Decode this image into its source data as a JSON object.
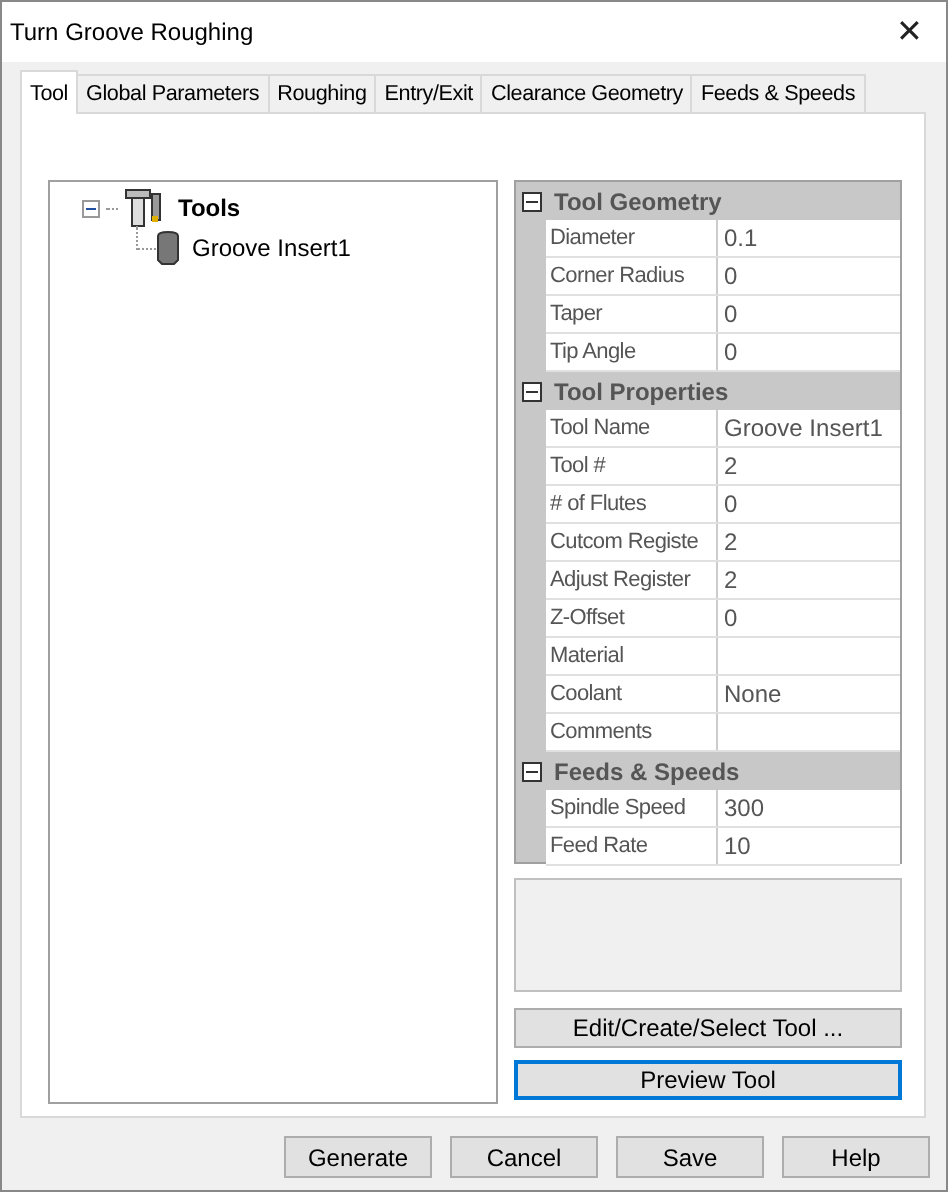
{
  "window": {
    "title": "Turn Groove Roughing",
    "close": "✕"
  },
  "tabs": [
    {
      "label": "Tool",
      "selected": true
    },
    {
      "label": "Global Parameters",
      "selected": false
    },
    {
      "label": "Roughing",
      "selected": false
    },
    {
      "label": "Entry/Exit",
      "selected": false
    },
    {
      "label": "Clearance Geometry",
      "selected": false
    },
    {
      "label": "Feeds & Speeds",
      "selected": false
    }
  ],
  "tree": {
    "label": "Tools",
    "expanded": true,
    "children": [
      {
        "label": "Groove Insert1"
      }
    ]
  },
  "properties": [
    {
      "category": "Tool Geometry",
      "expanded": true,
      "rows": [
        {
          "name": "Diameter",
          "value": "0.1"
        },
        {
          "name": "Corner Radius",
          "value": "0"
        },
        {
          "name": "Taper",
          "value": "0"
        },
        {
          "name": "Tip Angle",
          "value": "0"
        }
      ]
    },
    {
      "category": "Tool Properties",
      "expanded": true,
      "rows": [
        {
          "name": "Tool Name",
          "value": "Groove Insert1"
        },
        {
          "name": "Tool #",
          "value": "2"
        },
        {
          "name": "# of Flutes",
          "value": "0"
        },
        {
          "name": "Cutcom Registe",
          "value": "2"
        },
        {
          "name": "Adjust Register",
          "value": "2"
        },
        {
          "name": "Z-Offset",
          "value": "0"
        },
        {
          "name": "Material"
        },
        {
          "name": "Coolant",
          "value": "None"
        },
        {
          "name": "Comments"
        }
      ]
    },
    {
      "category": "Feeds & Speeds",
      "expanded": true,
      "rows": [
        {
          "name": "Spindle Speed",
          "value": "300"
        },
        {
          "name": "Feed Rate",
          "value": "10"
        }
      ]
    }
  ],
  "side_buttons": [
    {
      "label": "Edit/Create/Select Tool ...",
      "focused": false
    },
    {
      "label": "Preview Tool",
      "focused": true
    }
  ],
  "buttons": [
    "Generate",
    "Cancel",
    "Save",
    "Help"
  ]
}
